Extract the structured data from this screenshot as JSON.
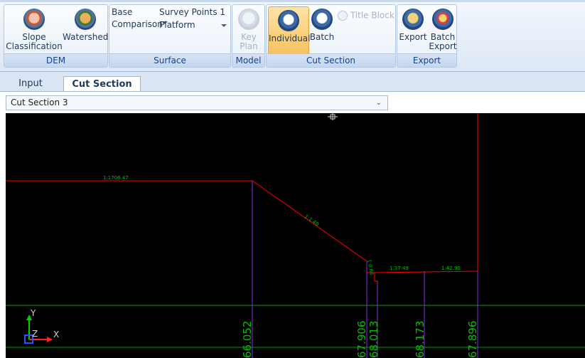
{
  "ribbon": {
    "dem": {
      "label": "DEM",
      "slope_label": "Slope",
      "classification_label": "Classification",
      "watershed_label": "Watershed"
    },
    "surface": {
      "label": "Surface",
      "base_label": "Base",
      "base_value": "Survey Points 1",
      "comparison_label": "Comparison",
      "comparison_value": "Platform"
    },
    "model": {
      "label": "Model",
      "key_plan_line1": "Key",
      "key_plan_line2": "Plan"
    },
    "cut_section": {
      "label": "Cut Section",
      "individual_label": "Individual",
      "batch_label": "Batch",
      "title_block_label": "Title Block"
    },
    "export": {
      "label": "Export",
      "export_label": "Export",
      "batch_line1": "Batch",
      "batch_line2": "Export"
    }
  },
  "tabs": [
    {
      "label": "Input",
      "active": false
    },
    {
      "label": "Cut Section",
      "active": true
    }
  ],
  "section_select": {
    "value": "Cut Section 3"
  },
  "canvas": {
    "slope_labels": [
      "1:1706.47",
      "1:1.40",
      "1:0.66",
      "1:37.49",
      "1:42.90"
    ],
    "elevation_labels": [
      "66.052",
      "67.906",
      "68.013",
      "68.173",
      "67.896"
    ],
    "axis": {
      "y": "Y",
      "z": "Z",
      "x": "X"
    },
    "colors": {
      "profile": "#ff0000",
      "verticals": "#8a2be2",
      "labels": "#00c000",
      "grid": "#00a000"
    }
  }
}
